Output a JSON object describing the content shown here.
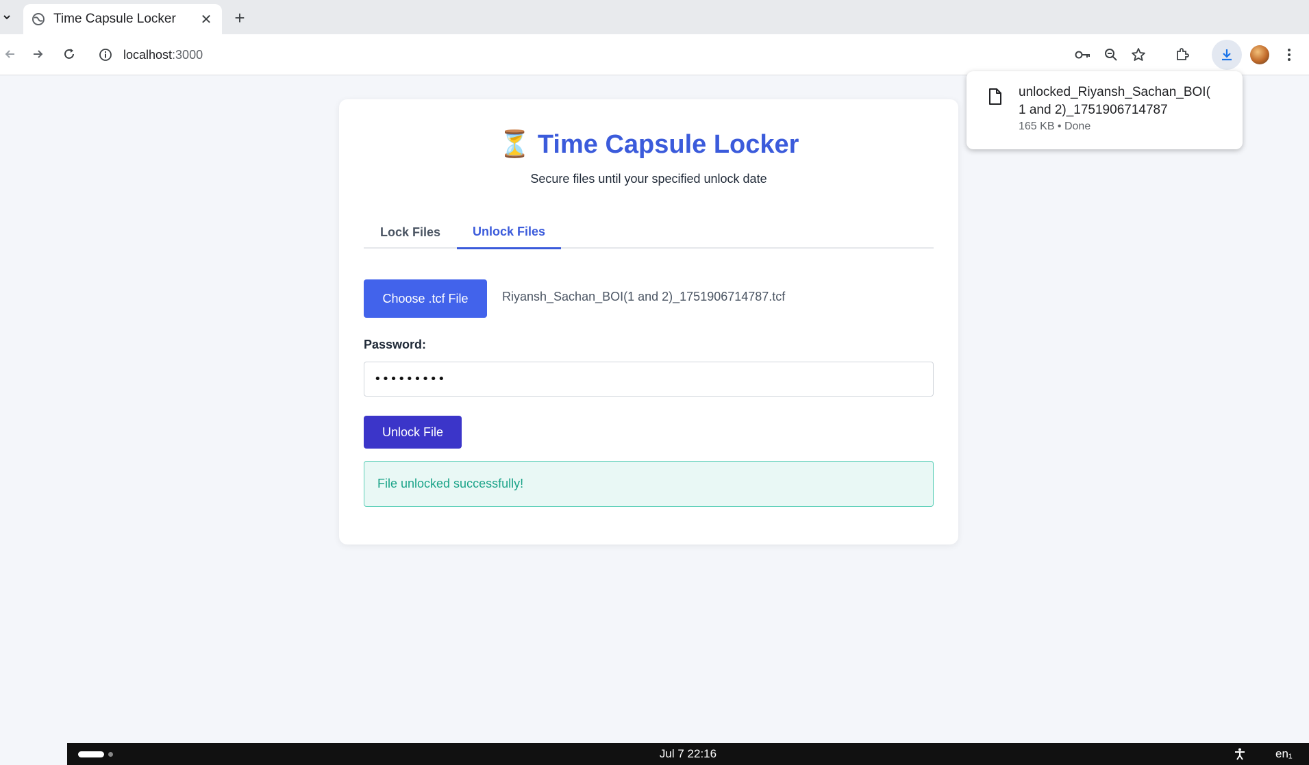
{
  "browser": {
    "tab_title": "Time Capsule Locker",
    "url_host": "localhost",
    "url_port": ":3000"
  },
  "page": {
    "title": "Time Capsule Locker",
    "title_emoji": "⏳",
    "subtitle": "Secure files until your specified unlock date",
    "tabs": [
      {
        "label": "Lock Files",
        "active": false
      },
      {
        "label": "Unlock Files",
        "active": true
      }
    ],
    "choose_button_label": "Choose .tcf File",
    "selected_file": "Riyansh_Sachan_BOI(1 and 2)_1751906714787.tcf",
    "password_label": "Password:",
    "password_value": "•••••••••",
    "unlock_button_label": "Unlock File",
    "success_message": "File unlocked successfully!"
  },
  "download": {
    "filename_line1": "unlocked_Riyansh_Sachan_BOI(",
    "filename_line2": "1 and 2)_1751906714787",
    "meta": "165 KB • Done"
  },
  "taskbar": {
    "clock": "Jul 7  22:16",
    "language": "en₁"
  },
  "colors": {
    "accent": "#3b5bdb",
    "choose_button": "#4263eb",
    "unlock_button": "#3b35c9",
    "success_text": "#1aa388",
    "success_bg": "#e9f8f5"
  }
}
